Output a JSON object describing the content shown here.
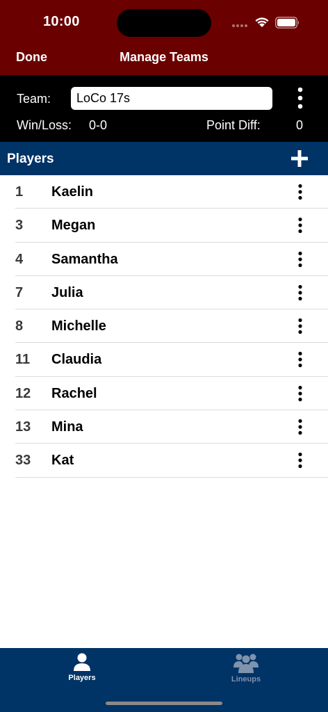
{
  "status_bar": {
    "time": "10:00"
  },
  "nav": {
    "done_label": "Done",
    "title": "Manage Teams"
  },
  "team": {
    "label": "Team:",
    "name_value": "LoCo 17s",
    "winloss_label": "Win/Loss:",
    "winloss_value": "0-0",
    "pointdiff_label": "Point Diff:",
    "pointdiff_value": "0"
  },
  "players_section": {
    "title": "Players"
  },
  "players": [
    {
      "number": "1",
      "name": "Kaelin"
    },
    {
      "number": "3",
      "name": "Megan"
    },
    {
      "number": "4",
      "name": "Samantha"
    },
    {
      "number": "7",
      "name": "Julia"
    },
    {
      "number": "8",
      "name": "Michelle"
    },
    {
      "number": "11",
      "name": "Claudia"
    },
    {
      "number": "12",
      "name": "Rachel"
    },
    {
      "number": "13",
      "name": "Mina"
    },
    {
      "number": "33",
      "name": "Kat"
    }
  ],
  "tab_bar": {
    "tabs": [
      {
        "label": "Players",
        "icon": "person-icon",
        "selected": true
      },
      {
        "label": "Lineups",
        "icon": "group-icon",
        "selected": false
      }
    ]
  },
  "colors": {
    "top_bar": "#6b0000",
    "team_panel": "#000000",
    "navy": "#003366",
    "inactive_tab": "#7f93ad"
  }
}
